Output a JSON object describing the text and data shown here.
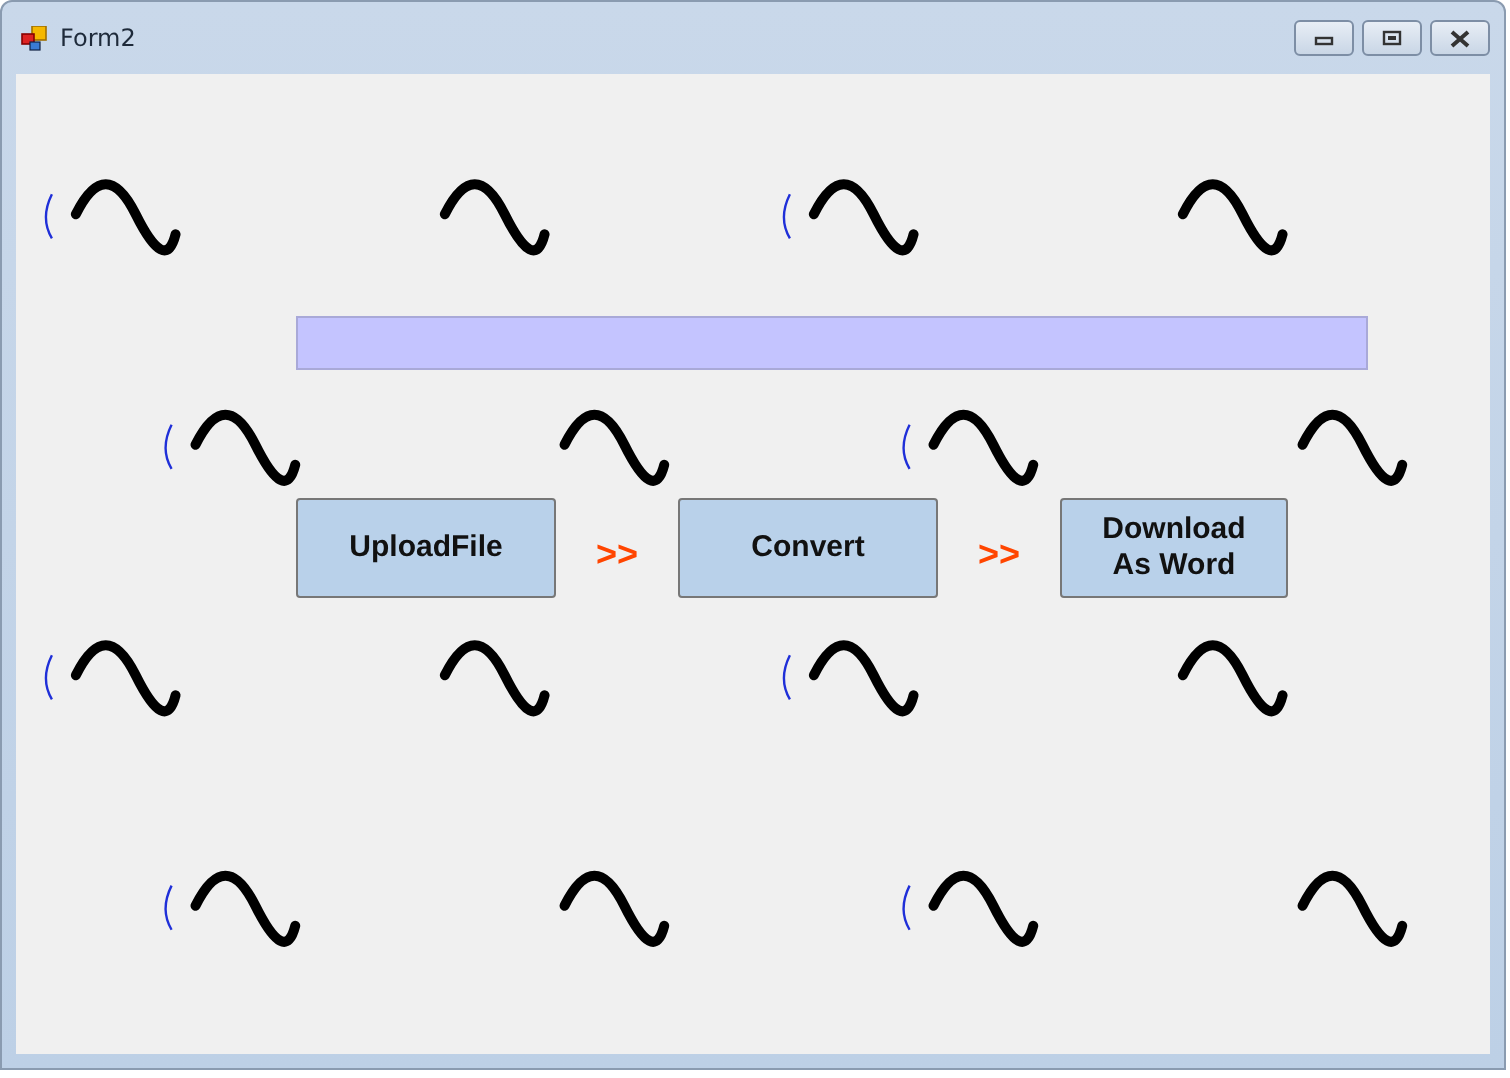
{
  "window": {
    "title": "Form2"
  },
  "actions": [
    {
      "kind": "button",
      "label": "UploadFile"
    },
    {
      "kind": "arrow",
      "label": ">>"
    },
    {
      "kind": "button",
      "label": "Convert"
    },
    {
      "kind": "arrow",
      "label": ">>"
    },
    {
      "kind": "button",
      "label": "Download As Word"
    }
  ]
}
